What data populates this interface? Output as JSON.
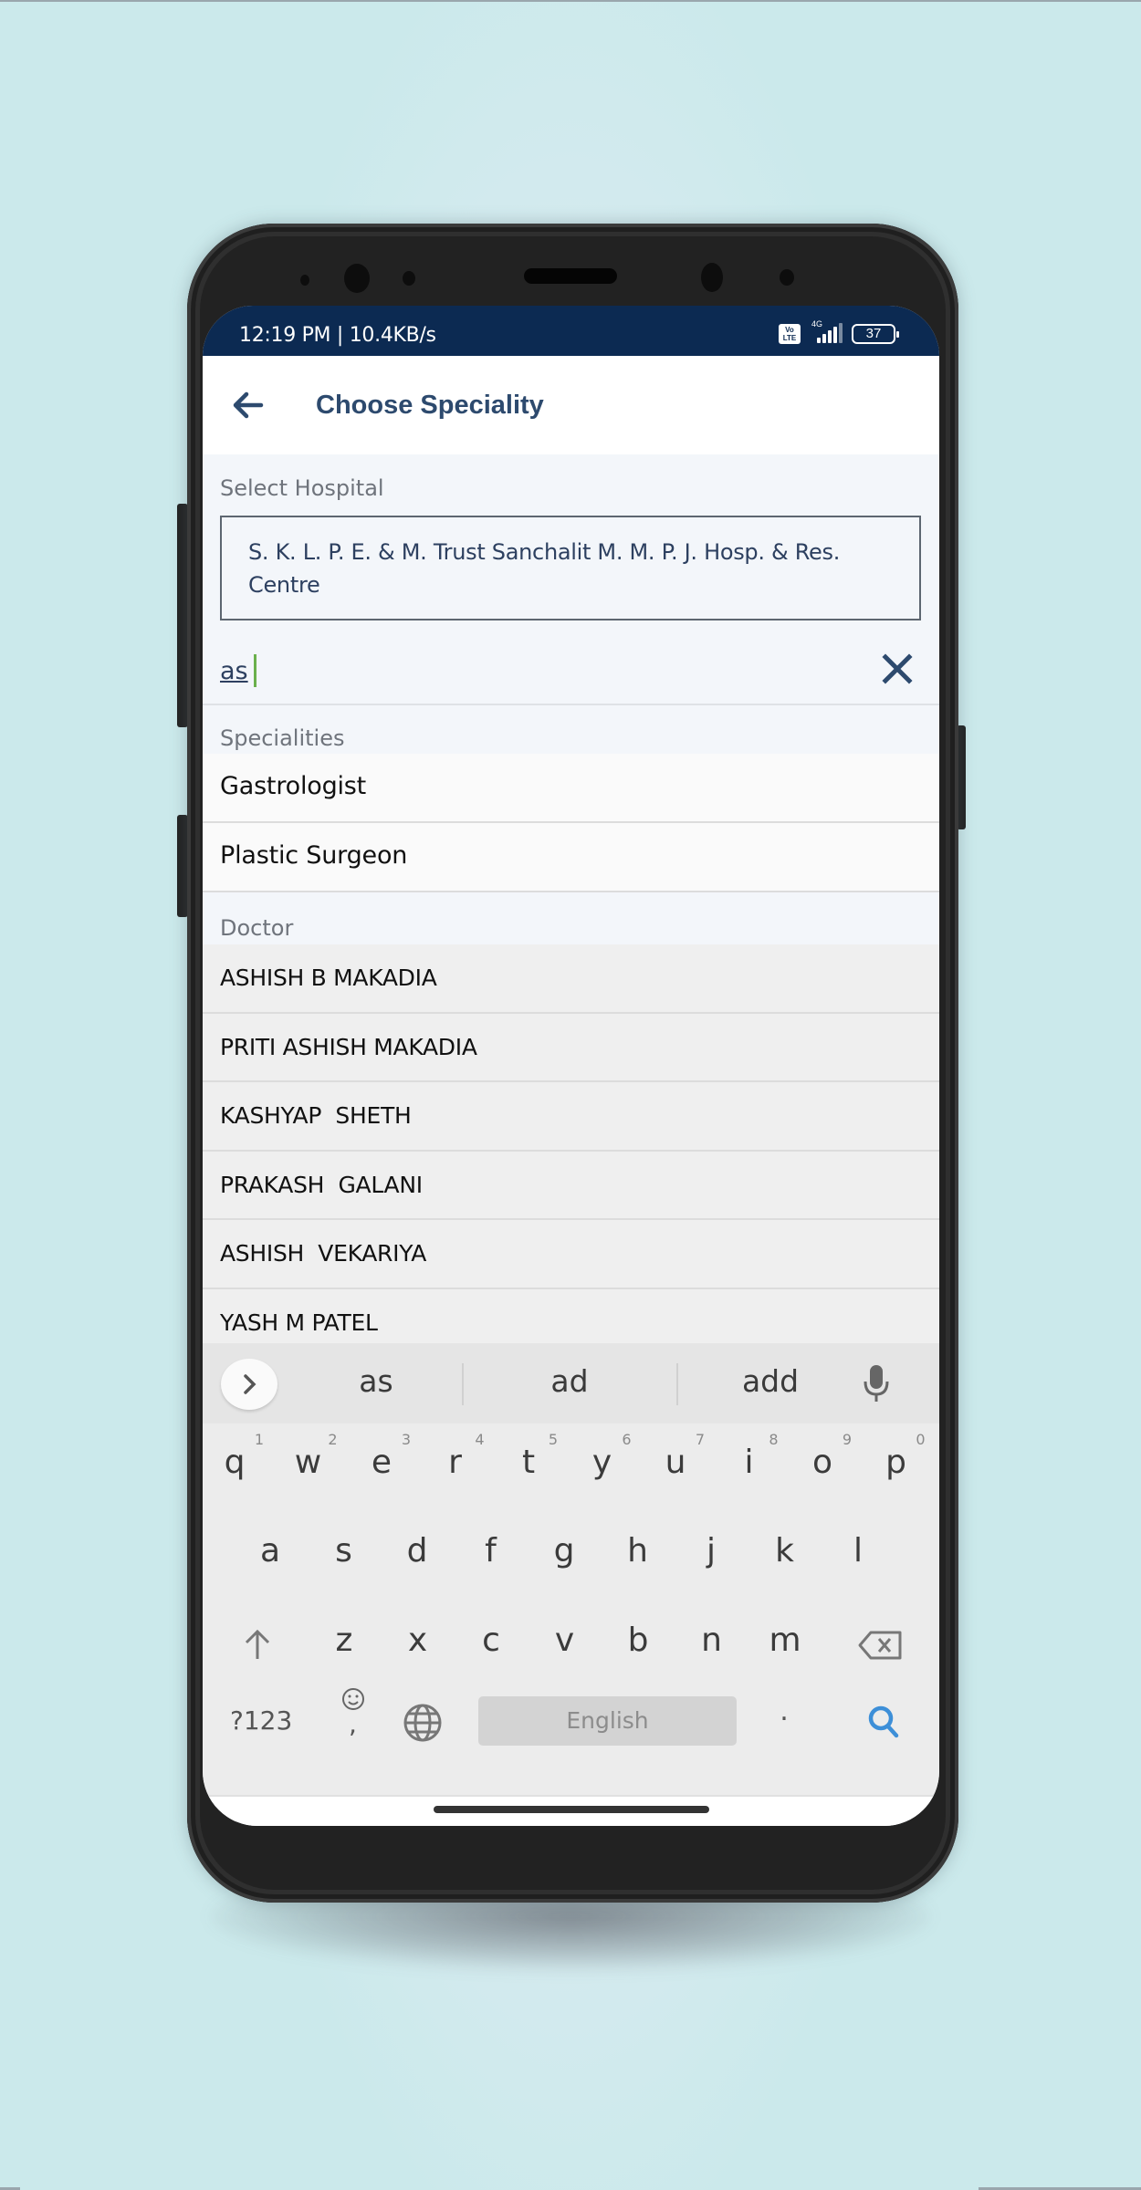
{
  "status_bar": {
    "time_speed": "12:19 PM | 10.4KB/s",
    "volte_label": "Vo\nLTE",
    "network_label": "4G",
    "battery": "37",
    "signal_level": 0.8
  },
  "app_bar": {
    "back_icon": "arrow-left-icon",
    "title": "Choose Speciality"
  },
  "hospital": {
    "label": "Select Hospital",
    "value": "S. K. L. P. E. & M. Trust Sanchalit M. M. P. J. Hosp. & Res. Centre"
  },
  "search": {
    "value": "as",
    "clear_icon": "close-icon"
  },
  "specialities": {
    "label": "Specialities",
    "items": [
      "Gastrologist",
      "Plastic Surgeon"
    ]
  },
  "doctors": {
    "label": "Doctor",
    "items": [
      "ASHISH B MAKADIA",
      "PRITI ASHISH MAKADIA",
      "KASHYAP  SHETH",
      "PRAKASH  GALANI",
      "ASHISH  VEKARIYA",
      "YASH M PATEL"
    ]
  },
  "keyboard": {
    "suggestions": [
      "as",
      "ad",
      "add"
    ],
    "row1": [
      {
        "key": "q",
        "num": "1"
      },
      {
        "key": "w",
        "num": "2"
      },
      {
        "key": "e",
        "num": "3"
      },
      {
        "key": "r",
        "num": "4"
      },
      {
        "key": "t",
        "num": "5"
      },
      {
        "key": "y",
        "num": "6"
      },
      {
        "key": "u",
        "num": "7"
      },
      {
        "key": "i",
        "num": "8"
      },
      {
        "key": "o",
        "num": "9"
      },
      {
        "key": "p",
        "num": "0"
      }
    ],
    "row2": [
      "a",
      "s",
      "d",
      "f",
      "g",
      "h",
      "j",
      "k",
      "l"
    ],
    "row3": [
      "z",
      "x",
      "c",
      "v",
      "b",
      "n",
      "m"
    ],
    "symbols_label": "?123",
    "comma_label": ",",
    "space_label": "English",
    "period_label": ".",
    "accent_color": "#3d8fd8"
  },
  "colors": {
    "status_bar": "#0c2a52",
    "title": "#2d4a6e",
    "caret": "#6ab04c"
  }
}
